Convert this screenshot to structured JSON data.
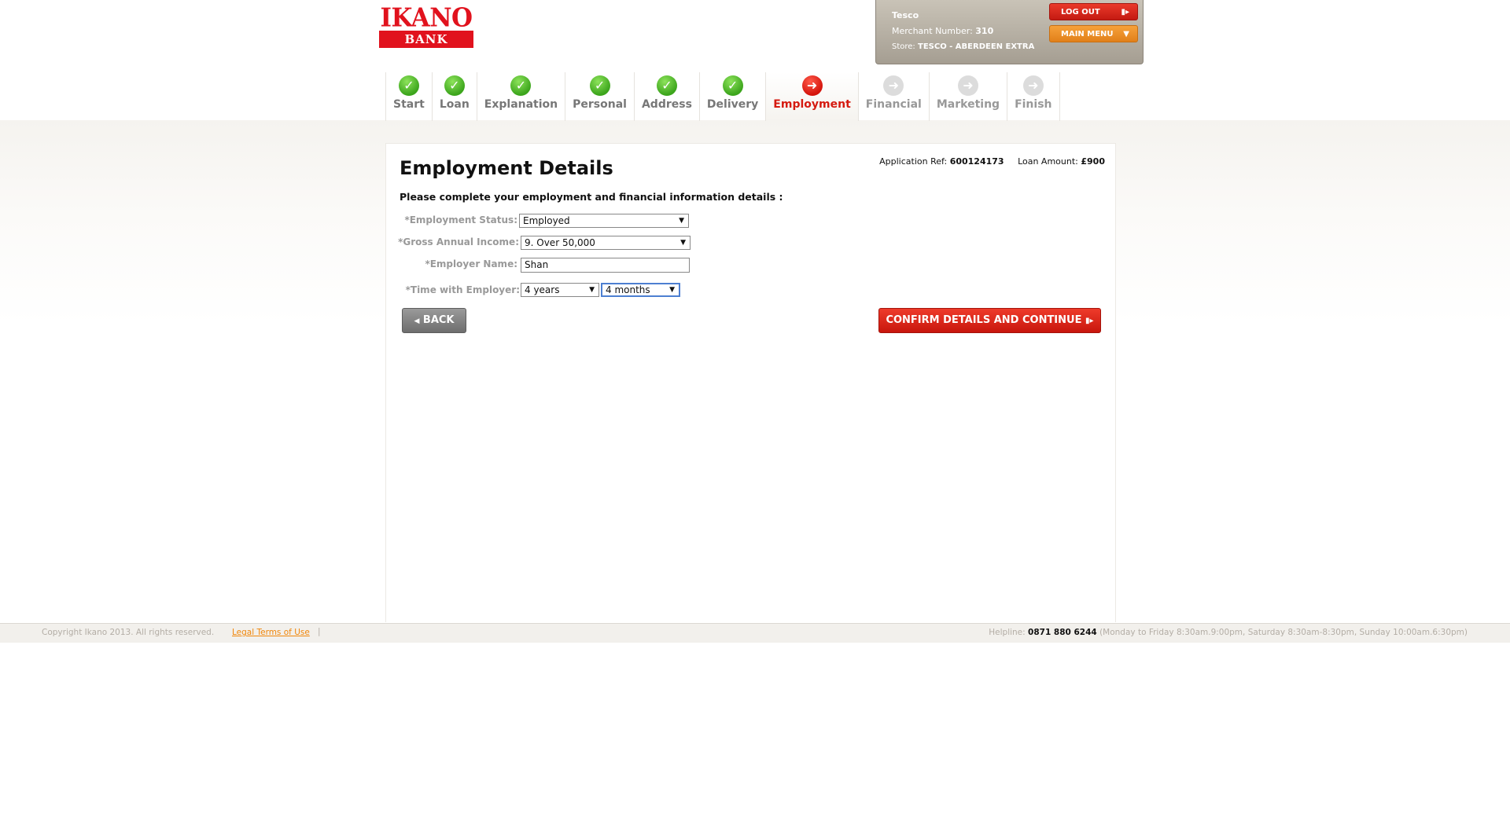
{
  "logo": {
    "line1": "IKANO",
    "line2": "BANK"
  },
  "merchant": {
    "name": "Tesco",
    "number_label": "Merchant Number:",
    "number": "310",
    "store_label": "Store:",
    "store": "TESCO - ABERDEEN EXTRA",
    "logout_label": "LOG OUT",
    "menu_label": "MAIN MENU"
  },
  "steps": [
    {
      "label": "Start",
      "state": "done"
    },
    {
      "label": "Loan",
      "state": "done"
    },
    {
      "label": "Explanation",
      "state": "done"
    },
    {
      "label": "Personal",
      "state": "done"
    },
    {
      "label": "Address",
      "state": "done"
    },
    {
      "label": "Delivery",
      "state": "done"
    },
    {
      "label": "Employment",
      "state": "active"
    },
    {
      "label": "Financial",
      "state": "todo"
    },
    {
      "label": "Marketing",
      "state": "todo"
    },
    {
      "label": "Finish",
      "state": "todo"
    }
  ],
  "page": {
    "title": "Employment Details",
    "ref_label": "Application Ref:",
    "ref_value": "600124173",
    "amount_label": "Loan Amount:",
    "amount_value": "£900",
    "intro": "Please complete your employment and financial information details :"
  },
  "form": {
    "employment_status_label": "*Employment Status:",
    "employment_status_value": "Employed",
    "income_label": "*Gross Annual Income:",
    "income_value": "9. Over 50,000",
    "employer_label": "*Employer Name:",
    "employer_value": "Shan",
    "time_label": "*Time with Employer:",
    "time_years_value": "4 years",
    "time_months_value": "4 months"
  },
  "buttons": {
    "back_label": "BACK",
    "confirm_label": "CONFIRM DETAILS AND CONTINUE"
  },
  "footer": {
    "copyright": "Copyright Ikano 2013. All rights reserved.",
    "legal": "Legal Terms of Use",
    "helpline_label": "Helpline:",
    "helpline_number": "0871 880 6244",
    "helpline_hours": "(Monday to Friday 8:30am.9:00pm, Saturday 8:30am-8:30pm, Sunday 10:00am.6:30pm)"
  }
}
